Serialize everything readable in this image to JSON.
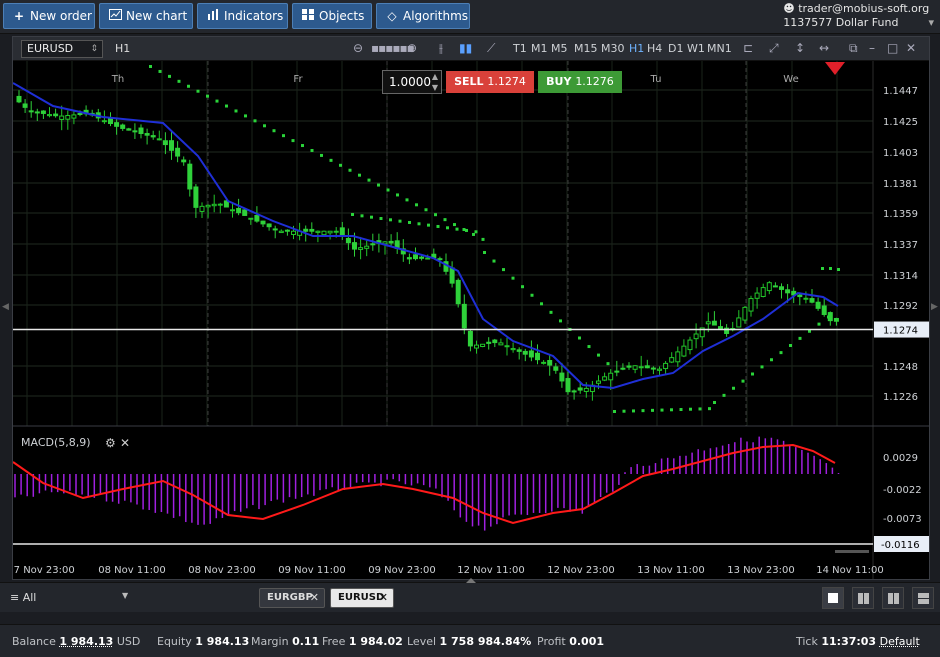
{
  "toolbar": {
    "new_order": "New order",
    "new_chart": "New chart",
    "indicators": "Indicators",
    "objects": "Objects",
    "algorithms": "Algorithms"
  },
  "account": {
    "user": "trader@mobius-soft.org",
    "id": "1137577",
    "fund": "Dollar Fund"
  },
  "chart": {
    "symbol": "EURUSD",
    "timeframe": "H1",
    "timeframes": [
      "T1",
      "M1",
      "M5",
      "M15",
      "M30",
      "H1",
      "H4",
      "D1",
      "W1",
      "MN1"
    ],
    "active_timeframe": "H1",
    "lot": "1.0000",
    "sell_label": "SELL",
    "sell_price": "1.1274",
    "buy_label": "BUY",
    "buy_price": "1.1276",
    "day_labels": [
      "Th",
      "Fr",
      "Tu",
      "We"
    ],
    "price_ticks": [
      "1.1447",
      "1.1425",
      "1.1403",
      "1.1381",
      "1.1359",
      "1.1337",
      "1.1314",
      "1.1292",
      "1.1248",
      "1.1226"
    ],
    "current_price": "1.1274",
    "macd_label": "MACD(5,8,9)",
    "macd_ticks": [
      "0.0029",
      "-0.0022",
      "-0.0073"
    ],
    "macd_current": "-0.0116",
    "time_labels": [
      "07 Nov 23:00",
      "08 Nov 11:00",
      "08 Nov 23:00",
      "09 Nov 11:00",
      "09 Nov 23:00",
      "12 Nov 11:00",
      "12 Nov 23:00",
      "13 Nov 11:00",
      "13 Nov 23:00",
      "14 Nov 11:00"
    ]
  },
  "colors": {
    "bull": "#22c52a",
    "bear": "#2fd13a",
    "ma": "#1f2fd6",
    "sar": "#2ad43a",
    "macd_hist": "#a020e0",
    "signal": "#ff1a1a"
  },
  "tabs": {
    "filter": "All",
    "items": [
      {
        "label": "EURGBP",
        "active": false
      },
      {
        "label": "EURUSD",
        "active": true
      }
    ]
  },
  "status": {
    "balance_label": "Balance",
    "balance": "1 984.13",
    "currency": "USD",
    "equity_label": "Equity",
    "equity": "1 984.13",
    "margin_label": "Margin",
    "margin": "0.11",
    "free_label": "Free",
    "free": "1 984.02",
    "level_label": "Level",
    "level": "1 758 984.84%",
    "profit_label": "Profit",
    "profit": "0.001",
    "tick_label": "Tick",
    "tick": "11:37:03",
    "tick_mode": "Default"
  }
}
